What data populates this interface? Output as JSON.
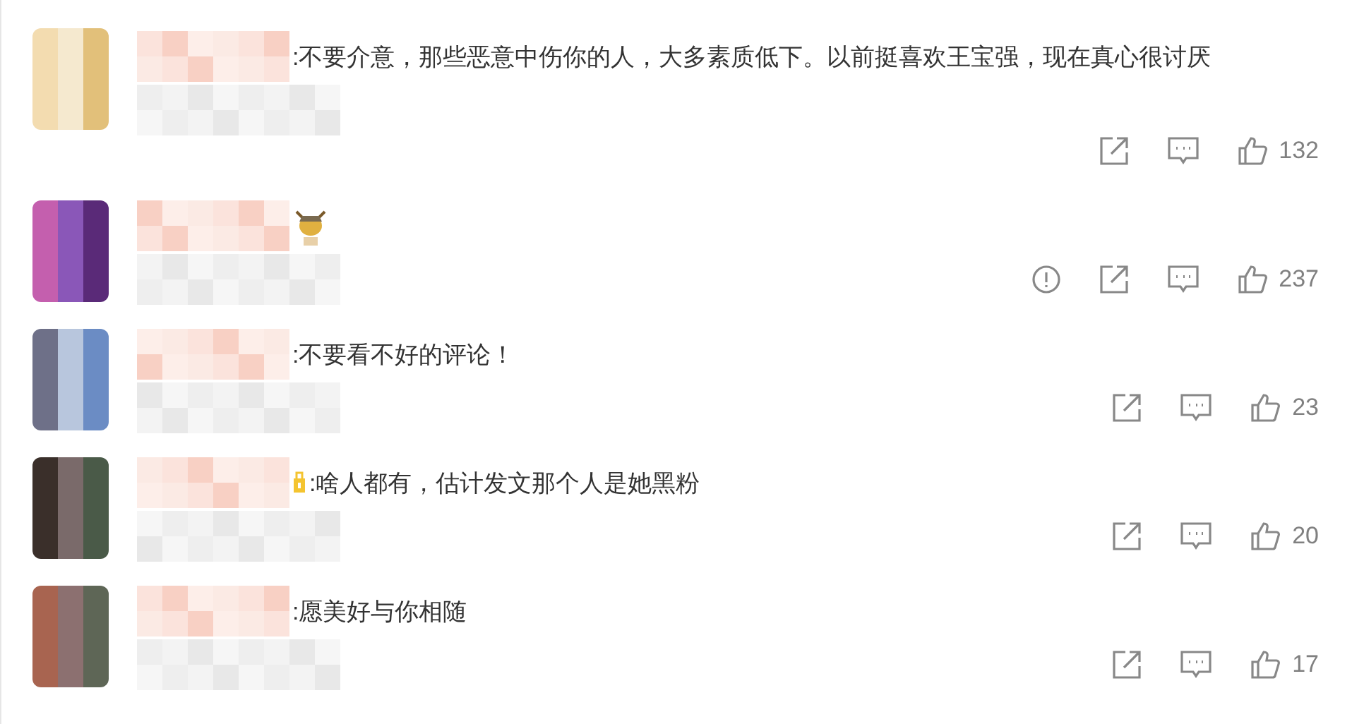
{
  "comments": [
    {
      "text": ":不要介意，那些恶意中伤你的人，大多素质低下。以前挺喜欢王宝强，现在真心很讨厌",
      "report": false,
      "likes": "132"
    },
    {
      "badge": {
        "kind": "figure"
      },
      "report": true,
      "likes": "237"
    },
    {
      "text": ":不要看不好的评论！",
      "report": false,
      "likes": "23"
    },
    {
      "badge": {
        "kind": "medal"
      },
      "text": ":啥人都有，估计发文那个人是她黑粉",
      "report": false,
      "likes": "20"
    },
    {
      "text": ":愿美好与你相随",
      "report": false,
      "likes": "17"
    }
  ]
}
